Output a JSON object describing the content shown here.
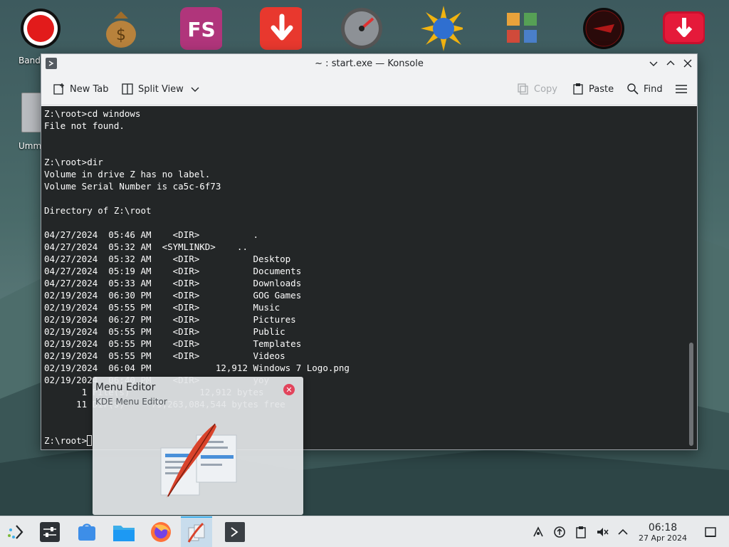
{
  "desktop": {
    "dock_label_1": "Band",
    "dock_label_2": "Umm",
    "fs_text": "FS"
  },
  "window": {
    "title": "~ : start.exe — Konsole",
    "toolbar": {
      "new_tab": "New Tab",
      "split_view": "Split View",
      "copy": "Copy",
      "paste": "Paste",
      "find": "Find"
    },
    "terminal_lines": [
      "Z:\\root>cd windows",
      "File not found.",
      "",
      "",
      "Z:\\root>dir",
      "Volume in drive Z has no label.",
      "Volume Serial Number is ca5c-6f73",
      "",
      "Directory of Z:\\root",
      "",
      "04/27/2024  05:46 AM    <DIR>          .",
      "04/27/2024  05:32 AM  <SYMLINKD>    ..",
      "04/27/2024  05:32 AM    <DIR>          Desktop",
      "04/27/2024  05:19 AM    <DIR>          Documents",
      "04/27/2024  05:33 AM    <DIR>          Downloads",
      "02/19/2024  06:30 PM    <DIR>          GOG Games",
      "02/19/2024  05:55 PM    <DIR>          Music",
      "02/19/2024  06:27 PM    <DIR>          Pictures",
      "02/19/2024  05:55 PM    <DIR>          Public",
      "02/19/2024  05:55 PM    <DIR>          Templates",
      "02/19/2024  05:55 PM    <DIR>          Videos",
      "02/19/2024  06:04 PM            12,912 Windows 7 Logo.png",
      "02/19/2024  06:40 PM    <DIR>          yoy",
      "       1 File(s)             12,912 bytes",
      "      11 Dir(s)     79,263,084,544 bytes free",
      "",
      ""
    ],
    "prompt": "Z:\\root>"
  },
  "preview": {
    "title": "Menu Editor",
    "subtitle": "KDE Menu Editor"
  },
  "taskbar": {
    "time": "06:18",
    "date": "27 Apr 2024"
  },
  "colors": {
    "terminal_bg": "#232627",
    "terminal_fg": "#fcfcfc",
    "accent": "#3daee9"
  }
}
